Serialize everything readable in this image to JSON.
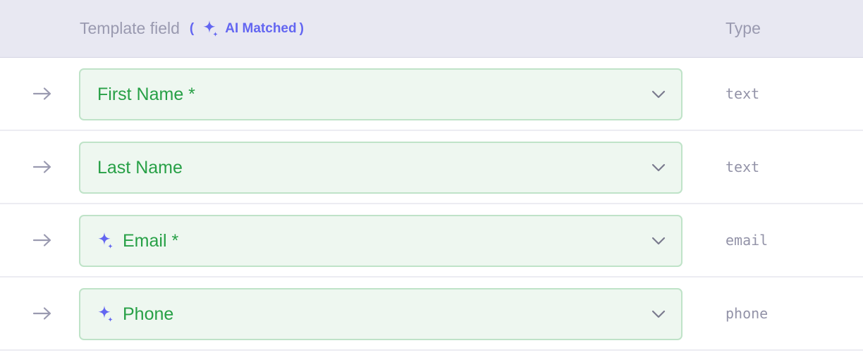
{
  "header": {
    "field_label": "Template field",
    "ai_open_paren": "(",
    "ai_label": "AI Matched",
    "ai_close_paren": ")",
    "type_label": "Type"
  },
  "colors": {
    "header_bg": "#e8e8f2",
    "accent": "#6366f1",
    "match_bg": "#eef7f0",
    "match_border": "#bfe3c8",
    "match_text": "#27a046"
  },
  "icons": {
    "row_arrow": "arrow-right-icon",
    "ai": "sparkle-icon",
    "dropdown": "chevron-down-icon"
  },
  "rows": [
    {
      "field": "First Name *",
      "type": "text",
      "ai_matched": false
    },
    {
      "field": "Last Name",
      "type": "text",
      "ai_matched": false
    },
    {
      "field": "Email *",
      "type": "email",
      "ai_matched": true
    },
    {
      "field": "Phone",
      "type": "phone",
      "ai_matched": true
    }
  ]
}
